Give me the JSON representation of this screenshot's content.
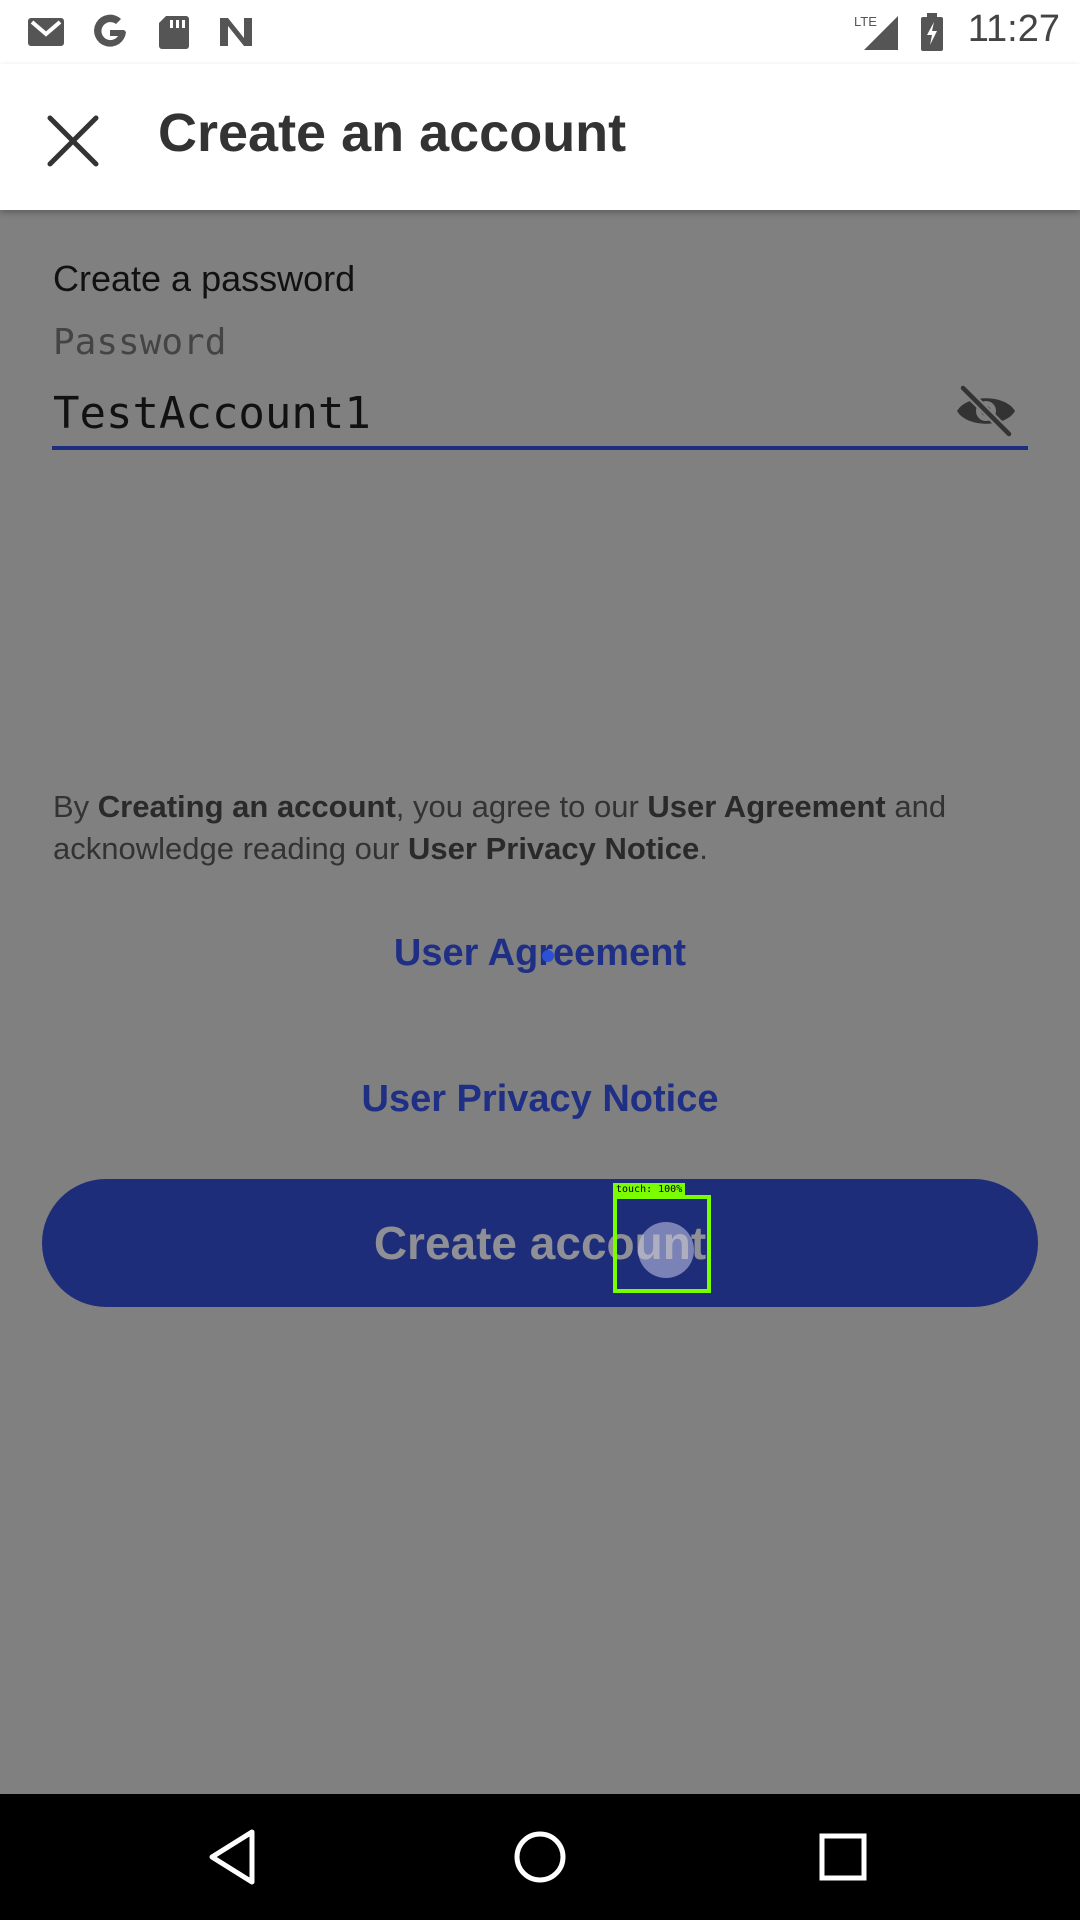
{
  "status_bar": {
    "time": "11:27",
    "left_icons": [
      "gmail-icon",
      "google-icon",
      "sd-card-icon",
      "n-app-icon"
    ],
    "right_icons": [
      "lte-signal-icon",
      "battery-charging-icon"
    ],
    "network_label": "LTE"
  },
  "app_bar": {
    "title": "Create an account",
    "close_icon": "close-icon"
  },
  "form": {
    "section_label": "Create a password",
    "password_label": "Password",
    "password_value": "TestAccount1",
    "visibility_icon": "eye-off-icon"
  },
  "legal": {
    "part1": "By ",
    "bold1": "Creating an account",
    "part2": ", you agree to our ",
    "bold2": "User Agreement",
    "part3": " and acknowledge reading our ",
    "bold3": "User Privacy Notice",
    "part4": "."
  },
  "links": {
    "user_agreement": "User Agreement",
    "user_privacy_notice": "User Privacy Notice"
  },
  "primary_button": {
    "label": "Create account"
  },
  "touch_indicator": {
    "label": "touch: 100%"
  },
  "nav_bar": {
    "icons": [
      "back-icon",
      "home-icon",
      "recents-icon"
    ]
  },
  "colors": {
    "scrim": "#808080",
    "accent": "#1e2d7a",
    "link": "#1e2f85",
    "touch": "#7cfc00"
  }
}
